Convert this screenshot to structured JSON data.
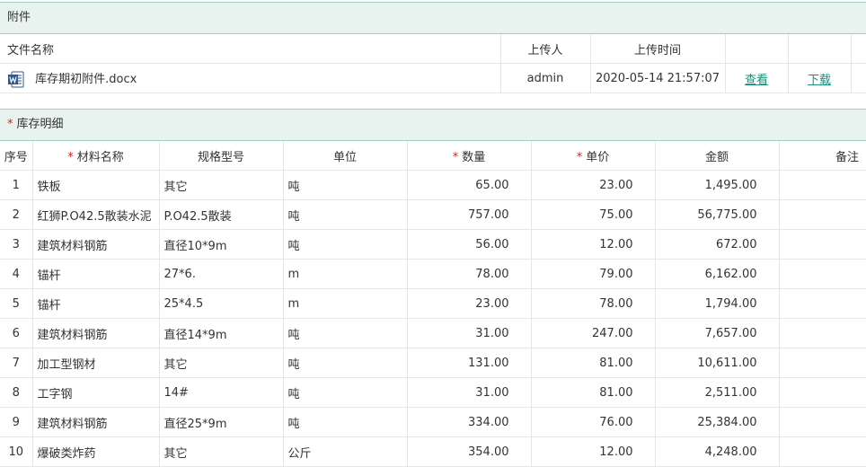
{
  "attachments": {
    "title": "附件",
    "headers": {
      "file_name": "文件名称",
      "uploader": "上传人",
      "upload_time": "上传时间"
    },
    "rows": [
      {
        "file_name": "库存期初附件.docx",
        "uploader": "admin",
        "upload_time": "2020-05-14 21:57:07",
        "view_label": "查看",
        "download_label": "下载",
        "icon": "word-doc-icon"
      }
    ]
  },
  "inventory": {
    "title": "库存明细",
    "required_mark": "*",
    "headers": {
      "index": "序号",
      "name": "材料名称",
      "spec": "规格型号",
      "unit": "单位",
      "qty": "数量",
      "price": "单价",
      "amount": "金额",
      "remark": "备注"
    },
    "rows": [
      {
        "index": "1",
        "name": "铁板",
        "spec": "其它",
        "unit": "吨",
        "qty": "65.00",
        "price": "23.00",
        "amount": "1,495.00",
        "remark": ""
      },
      {
        "index": "2",
        "name": "红狮P.O42.5散装水泥",
        "spec": "P.O42.5散装",
        "unit": "吨",
        "qty": "757.00",
        "price": "75.00",
        "amount": "56,775.00",
        "remark": ""
      },
      {
        "index": "3",
        "name": "建筑材料钢筋",
        "spec": "直径10*9m",
        "unit": "吨",
        "qty": "56.00",
        "price": "12.00",
        "amount": "672.00",
        "remark": ""
      },
      {
        "index": "4",
        "name": "锚杆",
        "spec": "27*6.",
        "unit": "m",
        "qty": "78.00",
        "price": "79.00",
        "amount": "6,162.00",
        "remark": ""
      },
      {
        "index": "5",
        "name": "锚杆",
        "spec": "25*4.5",
        "unit": "m",
        "qty": "23.00",
        "price": "78.00",
        "amount": "1,794.00",
        "remark": ""
      },
      {
        "index": "6",
        "name": "建筑材料钢筋",
        "spec": "直径14*9m",
        "unit": "吨",
        "qty": "31.00",
        "price": "247.00",
        "amount": "7,657.00",
        "remark": ""
      },
      {
        "index": "7",
        "name": "加工型钢材",
        "spec": "其它",
        "unit": "吨",
        "qty": "131.00",
        "price": "81.00",
        "amount": "10,611.00",
        "remark": ""
      },
      {
        "index": "8",
        "name": "工字钢",
        "spec": "14#",
        "unit": "吨",
        "qty": "31.00",
        "price": "81.00",
        "amount": "2,511.00",
        "remark": ""
      },
      {
        "index": "9",
        "name": "建筑材料钢筋",
        "spec": "直径25*9m",
        "unit": "吨",
        "qty": "334.00",
        "price": "76.00",
        "amount": "25,384.00",
        "remark": ""
      },
      {
        "index": "10",
        "name": "爆破类炸药",
        "spec": "其它",
        "unit": "公斤",
        "qty": "354.00",
        "price": "12.00",
        "amount": "4,248.00",
        "remark": ""
      }
    ]
  },
  "colors": {
    "header_bg": "#e8f3f0",
    "header_border": "#9fcfc2",
    "link": "#1a8f7a",
    "required": "#e02020"
  }
}
